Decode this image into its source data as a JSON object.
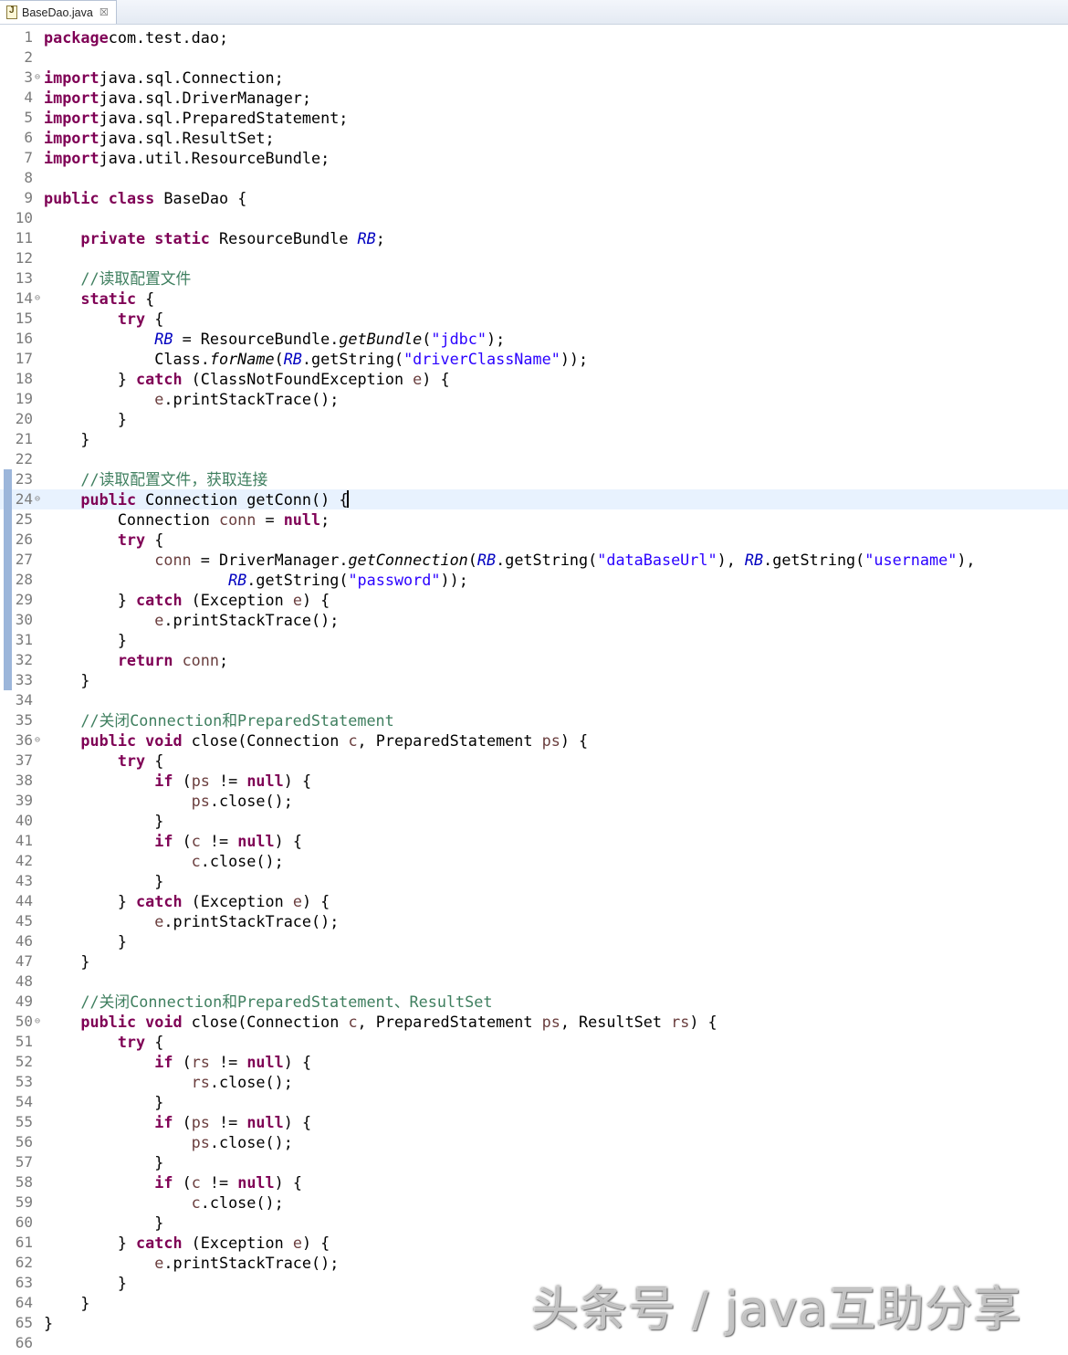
{
  "tab": {
    "filename": "BaseDao.java",
    "close_glyph": "☒",
    "icon": "java-file-icon"
  },
  "editor": {
    "current_line": 24,
    "lines": [
      {
        "n": "1",
        "tokens": [
          [
            "kw",
            "package"
          ],
          [
            "",
            "com.test.dao;"
          ]
        ]
      },
      {
        "n": "2",
        "tokens": []
      },
      {
        "n": "3",
        "fold": true,
        "tokens": [
          [
            "kw",
            "import"
          ],
          [
            "",
            "java.sql.Connection;"
          ]
        ]
      },
      {
        "n": "4",
        "tokens": [
          [
            "kw",
            "import"
          ],
          [
            "",
            "java.sql.DriverManager;"
          ]
        ]
      },
      {
        "n": "5",
        "tokens": [
          [
            "kw",
            "import"
          ],
          [
            "",
            "java.sql.PreparedStatement;"
          ]
        ]
      },
      {
        "n": "6",
        "tokens": [
          [
            "kw",
            "import"
          ],
          [
            "",
            "java.sql.ResultSet;"
          ]
        ]
      },
      {
        "n": "7",
        "tokens": [
          [
            "kw",
            "import"
          ],
          [
            "",
            "java.util.ResourceBundle;"
          ]
        ]
      },
      {
        "n": "8",
        "tokens": []
      },
      {
        "n": "9",
        "tokens": [
          [
            "kw",
            "public"
          ],
          [
            "",
            " "
          ],
          [
            "kw",
            "class"
          ],
          [
            "",
            " BaseDao {"
          ]
        ]
      },
      {
        "n": "10",
        "tokens": []
      },
      {
        "n": "11",
        "tokens": [
          [
            "",
            "    "
          ],
          [
            "kw",
            "private"
          ],
          [
            "",
            " "
          ],
          [
            "kw",
            "static"
          ],
          [
            "",
            " ResourceBundle "
          ],
          [
            "fld",
            "RB"
          ],
          [
            "",
            ";"
          ]
        ]
      },
      {
        "n": "12",
        "tokens": []
      },
      {
        "n": "13",
        "tokens": [
          [
            "",
            "    "
          ],
          [
            "cm",
            "//读取配置文件"
          ]
        ]
      },
      {
        "n": "14",
        "fold": true,
        "tokens": [
          [
            "",
            "    "
          ],
          [
            "kw",
            "static"
          ],
          [
            "",
            " {"
          ]
        ]
      },
      {
        "n": "15",
        "tokens": [
          [
            "",
            "        "
          ],
          [
            "kw",
            "try"
          ],
          [
            "",
            " {"
          ]
        ]
      },
      {
        "n": "16",
        "tokens": [
          [
            "",
            "            "
          ],
          [
            "fld",
            "RB"
          ],
          [
            "",
            " = ResourceBundle."
          ],
          [
            "sm",
            "getBundle"
          ],
          [
            "",
            "("
          ],
          [
            "st",
            "\"jdbc\""
          ],
          [
            "",
            ");"
          ]
        ]
      },
      {
        "n": "17",
        "tokens": [
          [
            "",
            "            Class."
          ],
          [
            "sm",
            "forName"
          ],
          [
            "",
            "("
          ],
          [
            "fld",
            "RB"
          ],
          [
            "",
            ".getString("
          ],
          [
            "st",
            "\"driverClassName\""
          ],
          [
            "",
            "));"
          ]
        ]
      },
      {
        "n": "18",
        "tokens": [
          [
            "",
            "        } "
          ],
          [
            "kw",
            "catch"
          ],
          [
            "",
            " (ClassNotFoundException "
          ],
          [
            "var",
            "e"
          ],
          [
            "",
            ") {"
          ]
        ]
      },
      {
        "n": "19",
        "tokens": [
          [
            "",
            "            "
          ],
          [
            "var",
            "e"
          ],
          [
            "",
            ".printStackTrace();"
          ]
        ]
      },
      {
        "n": "20",
        "tokens": [
          [
            "",
            "        }"
          ]
        ]
      },
      {
        "n": "21",
        "tokens": [
          [
            "",
            "    }"
          ]
        ]
      },
      {
        "n": "22",
        "tokens": []
      },
      {
        "n": "23",
        "mark": true,
        "tokens": [
          [
            "",
            "    "
          ],
          [
            "cm",
            "//读取配置文件，获取连接"
          ]
        ]
      },
      {
        "n": "24",
        "mark": true,
        "fold": true,
        "tokens": [
          [
            "",
            "    "
          ],
          [
            "kw",
            "public"
          ],
          [
            "",
            " Connection getConn() {"
          ],
          [
            "caret",
            ""
          ]
        ]
      },
      {
        "n": "25",
        "mark": true,
        "tokens": [
          [
            "",
            "        Connection "
          ],
          [
            "var",
            "conn"
          ],
          [
            "",
            " = "
          ],
          [
            "kw",
            "null"
          ],
          [
            "",
            ";"
          ]
        ]
      },
      {
        "n": "26",
        "mark": true,
        "tokens": [
          [
            "",
            "        "
          ],
          [
            "kw",
            "try"
          ],
          [
            "",
            " {"
          ]
        ]
      },
      {
        "n": "27",
        "mark": true,
        "tokens": [
          [
            "",
            "            "
          ],
          [
            "var",
            "conn"
          ],
          [
            "",
            " = DriverManager."
          ],
          [
            "sm",
            "getConnection"
          ],
          [
            "",
            "("
          ],
          [
            "fld",
            "RB"
          ],
          [
            "",
            ".getString("
          ],
          [
            "st",
            "\"dataBaseUrl\""
          ],
          [
            "",
            "), "
          ],
          [
            "fld",
            "RB"
          ],
          [
            "",
            ".getString("
          ],
          [
            "st",
            "\"username\""
          ],
          [
            "",
            "),"
          ]
        ]
      },
      {
        "n": "28",
        "mark": true,
        "tokens": [
          [
            "",
            "                    "
          ],
          [
            "fld",
            "RB"
          ],
          [
            "",
            ".getString("
          ],
          [
            "st",
            "\"password\""
          ],
          [
            "",
            "));"
          ]
        ]
      },
      {
        "n": "29",
        "mark": true,
        "tokens": [
          [
            "",
            "        } "
          ],
          [
            "kw",
            "catch"
          ],
          [
            "",
            " (Exception "
          ],
          [
            "var",
            "e"
          ],
          [
            "",
            ") {"
          ]
        ]
      },
      {
        "n": "30",
        "mark": true,
        "tokens": [
          [
            "",
            "            "
          ],
          [
            "var",
            "e"
          ],
          [
            "",
            ".printStackTrace();"
          ]
        ]
      },
      {
        "n": "31",
        "mark": true,
        "tokens": [
          [
            "",
            "        }"
          ]
        ]
      },
      {
        "n": "32",
        "mark": true,
        "tokens": [
          [
            "",
            "        "
          ],
          [
            "kw",
            "return"
          ],
          [
            "",
            " "
          ],
          [
            "var",
            "conn"
          ],
          [
            "",
            ";"
          ]
        ]
      },
      {
        "n": "33",
        "mark": true,
        "tokens": [
          [
            "",
            "    }"
          ]
        ]
      },
      {
        "n": "34",
        "tokens": []
      },
      {
        "n": "35",
        "tokens": [
          [
            "",
            "    "
          ],
          [
            "cm",
            "//关闭Connection和PreparedStatement"
          ]
        ]
      },
      {
        "n": "36",
        "fold": true,
        "tokens": [
          [
            "",
            "    "
          ],
          [
            "kw",
            "public"
          ],
          [
            "",
            " "
          ],
          [
            "kw",
            "void"
          ],
          [
            "",
            " close(Connection "
          ],
          [
            "var",
            "c"
          ],
          [
            "",
            ", PreparedStatement "
          ],
          [
            "var",
            "ps"
          ],
          [
            "",
            ") {"
          ]
        ]
      },
      {
        "n": "37",
        "tokens": [
          [
            "",
            "        "
          ],
          [
            "kw",
            "try"
          ],
          [
            "",
            " {"
          ]
        ]
      },
      {
        "n": "38",
        "tokens": [
          [
            "",
            "            "
          ],
          [
            "kw",
            "if"
          ],
          [
            "",
            " ("
          ],
          [
            "var",
            "ps"
          ],
          [
            "",
            " != "
          ],
          [
            "kw",
            "null"
          ],
          [
            "",
            ") {"
          ]
        ]
      },
      {
        "n": "39",
        "tokens": [
          [
            "",
            "                "
          ],
          [
            "var",
            "ps"
          ],
          [
            "",
            ".close();"
          ]
        ]
      },
      {
        "n": "40",
        "tokens": [
          [
            "",
            "            }"
          ]
        ]
      },
      {
        "n": "41",
        "tokens": [
          [
            "",
            "            "
          ],
          [
            "kw",
            "if"
          ],
          [
            "",
            " ("
          ],
          [
            "var",
            "c"
          ],
          [
            "",
            " != "
          ],
          [
            "kw",
            "null"
          ],
          [
            "",
            ") {"
          ]
        ]
      },
      {
        "n": "42",
        "tokens": [
          [
            "",
            "                "
          ],
          [
            "var",
            "c"
          ],
          [
            "",
            ".close();"
          ]
        ]
      },
      {
        "n": "43",
        "tokens": [
          [
            "",
            "            }"
          ]
        ]
      },
      {
        "n": "44",
        "tokens": [
          [
            "",
            "        } "
          ],
          [
            "kw",
            "catch"
          ],
          [
            "",
            " (Exception "
          ],
          [
            "var",
            "e"
          ],
          [
            "",
            ") {"
          ]
        ]
      },
      {
        "n": "45",
        "tokens": [
          [
            "",
            "            "
          ],
          [
            "var",
            "e"
          ],
          [
            "",
            ".printStackTrace();"
          ]
        ]
      },
      {
        "n": "46",
        "tokens": [
          [
            "",
            "        }"
          ]
        ]
      },
      {
        "n": "47",
        "tokens": [
          [
            "",
            "    }"
          ]
        ]
      },
      {
        "n": "48",
        "tokens": []
      },
      {
        "n": "49",
        "tokens": [
          [
            "",
            "    "
          ],
          [
            "cm",
            "//关闭Connection和PreparedStatement、ResultSet"
          ]
        ]
      },
      {
        "n": "50",
        "fold": true,
        "tokens": [
          [
            "",
            "    "
          ],
          [
            "kw",
            "public"
          ],
          [
            "",
            " "
          ],
          [
            "kw",
            "void"
          ],
          [
            "",
            " close(Connection "
          ],
          [
            "var",
            "c"
          ],
          [
            "",
            ", PreparedStatement "
          ],
          [
            "var",
            "ps"
          ],
          [
            "",
            ", ResultSet "
          ],
          [
            "var",
            "rs"
          ],
          [
            "",
            ") {"
          ]
        ]
      },
      {
        "n": "51",
        "tokens": [
          [
            "",
            "        "
          ],
          [
            "kw",
            "try"
          ],
          [
            "",
            " {"
          ]
        ]
      },
      {
        "n": "52",
        "tokens": [
          [
            "",
            "            "
          ],
          [
            "kw",
            "if"
          ],
          [
            "",
            " ("
          ],
          [
            "var",
            "rs"
          ],
          [
            "",
            " != "
          ],
          [
            "kw",
            "null"
          ],
          [
            "",
            ") {"
          ]
        ]
      },
      {
        "n": "53",
        "tokens": [
          [
            "",
            "                "
          ],
          [
            "var",
            "rs"
          ],
          [
            "",
            ".close();"
          ]
        ]
      },
      {
        "n": "54",
        "tokens": [
          [
            "",
            "            }"
          ]
        ]
      },
      {
        "n": "55",
        "tokens": [
          [
            "",
            "            "
          ],
          [
            "kw",
            "if"
          ],
          [
            "",
            " ("
          ],
          [
            "var",
            "ps"
          ],
          [
            "",
            " != "
          ],
          [
            "kw",
            "null"
          ],
          [
            "",
            ") {"
          ]
        ]
      },
      {
        "n": "56",
        "tokens": [
          [
            "",
            "                "
          ],
          [
            "var",
            "ps"
          ],
          [
            "",
            ".close();"
          ]
        ]
      },
      {
        "n": "57",
        "tokens": [
          [
            "",
            "            }"
          ]
        ]
      },
      {
        "n": "58",
        "tokens": [
          [
            "",
            "            "
          ],
          [
            "kw",
            "if"
          ],
          [
            "",
            " ("
          ],
          [
            "var",
            "c"
          ],
          [
            "",
            " != "
          ],
          [
            "kw",
            "null"
          ],
          [
            "",
            ") {"
          ]
        ]
      },
      {
        "n": "59",
        "tokens": [
          [
            "",
            "                "
          ],
          [
            "var",
            "c"
          ],
          [
            "",
            ".close();"
          ]
        ]
      },
      {
        "n": "60",
        "tokens": [
          [
            "",
            "            }"
          ]
        ]
      },
      {
        "n": "61",
        "tokens": [
          [
            "",
            "        } "
          ],
          [
            "kw",
            "catch"
          ],
          [
            "",
            " (Exception "
          ],
          [
            "var",
            "e"
          ],
          [
            "",
            ") {"
          ]
        ]
      },
      {
        "n": "62",
        "tokens": [
          [
            "",
            "            "
          ],
          [
            "var",
            "e"
          ],
          [
            "",
            ".printStackTrace();"
          ]
        ]
      },
      {
        "n": "63",
        "tokens": [
          [
            "",
            "        }"
          ]
        ]
      },
      {
        "n": "64",
        "tokens": [
          [
            "",
            "    }"
          ]
        ]
      },
      {
        "n": "65",
        "tokens": [
          [
            "",
            "}"
          ]
        ]
      },
      {
        "n": "66",
        "tokens": []
      }
    ]
  },
  "watermark": {
    "text": "头条号 / java互助分享"
  }
}
